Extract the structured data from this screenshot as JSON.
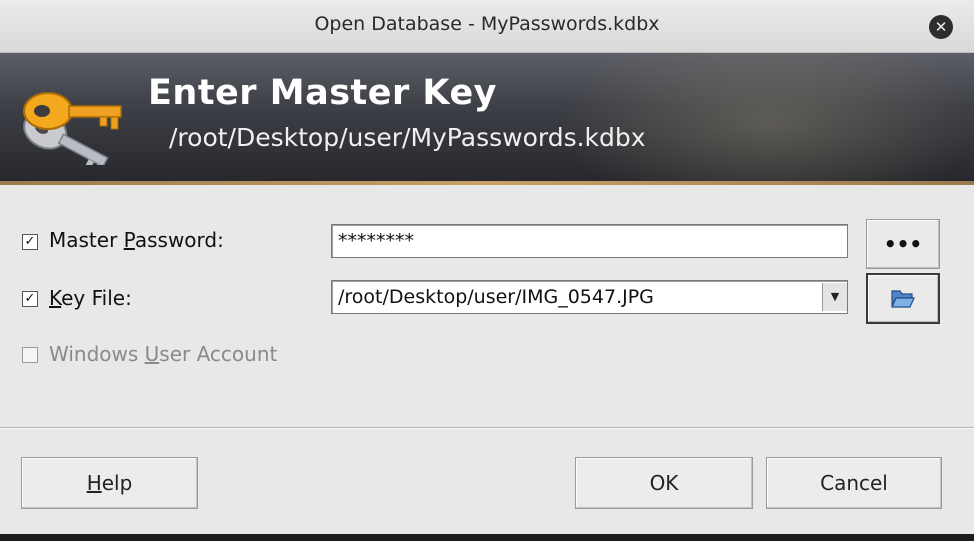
{
  "window": {
    "title": "Open Database - MyPasswords.kdbx",
    "close_icon": "close-icon"
  },
  "banner": {
    "heading": "Enter Master Key",
    "path": "/root/Desktop/user/MyPasswords.kdbx",
    "icon": "key-icon"
  },
  "form": {
    "master_password": {
      "checked": true,
      "label_before": "Master ",
      "label_underlined": "P",
      "label_after": "assword:",
      "value": "********",
      "reveal_label": "•••"
    },
    "key_file": {
      "checked": true,
      "label_before": "",
      "label_underlined": "K",
      "label_after": "ey File:",
      "value": "/root/Desktop/user/IMG_0547.JPG",
      "browse_icon": "folder-open-icon"
    },
    "windows_account": {
      "checked": false,
      "enabled": false,
      "label_before": "Windows ",
      "label_underlined": "U",
      "label_after": "ser Account"
    }
  },
  "buttons": {
    "help_underlined": "H",
    "help_rest": "elp",
    "ok": "OK",
    "cancel": "Cancel"
  },
  "colors": {
    "banner_dark": "#26272c",
    "accent_key": "#f0a020"
  }
}
